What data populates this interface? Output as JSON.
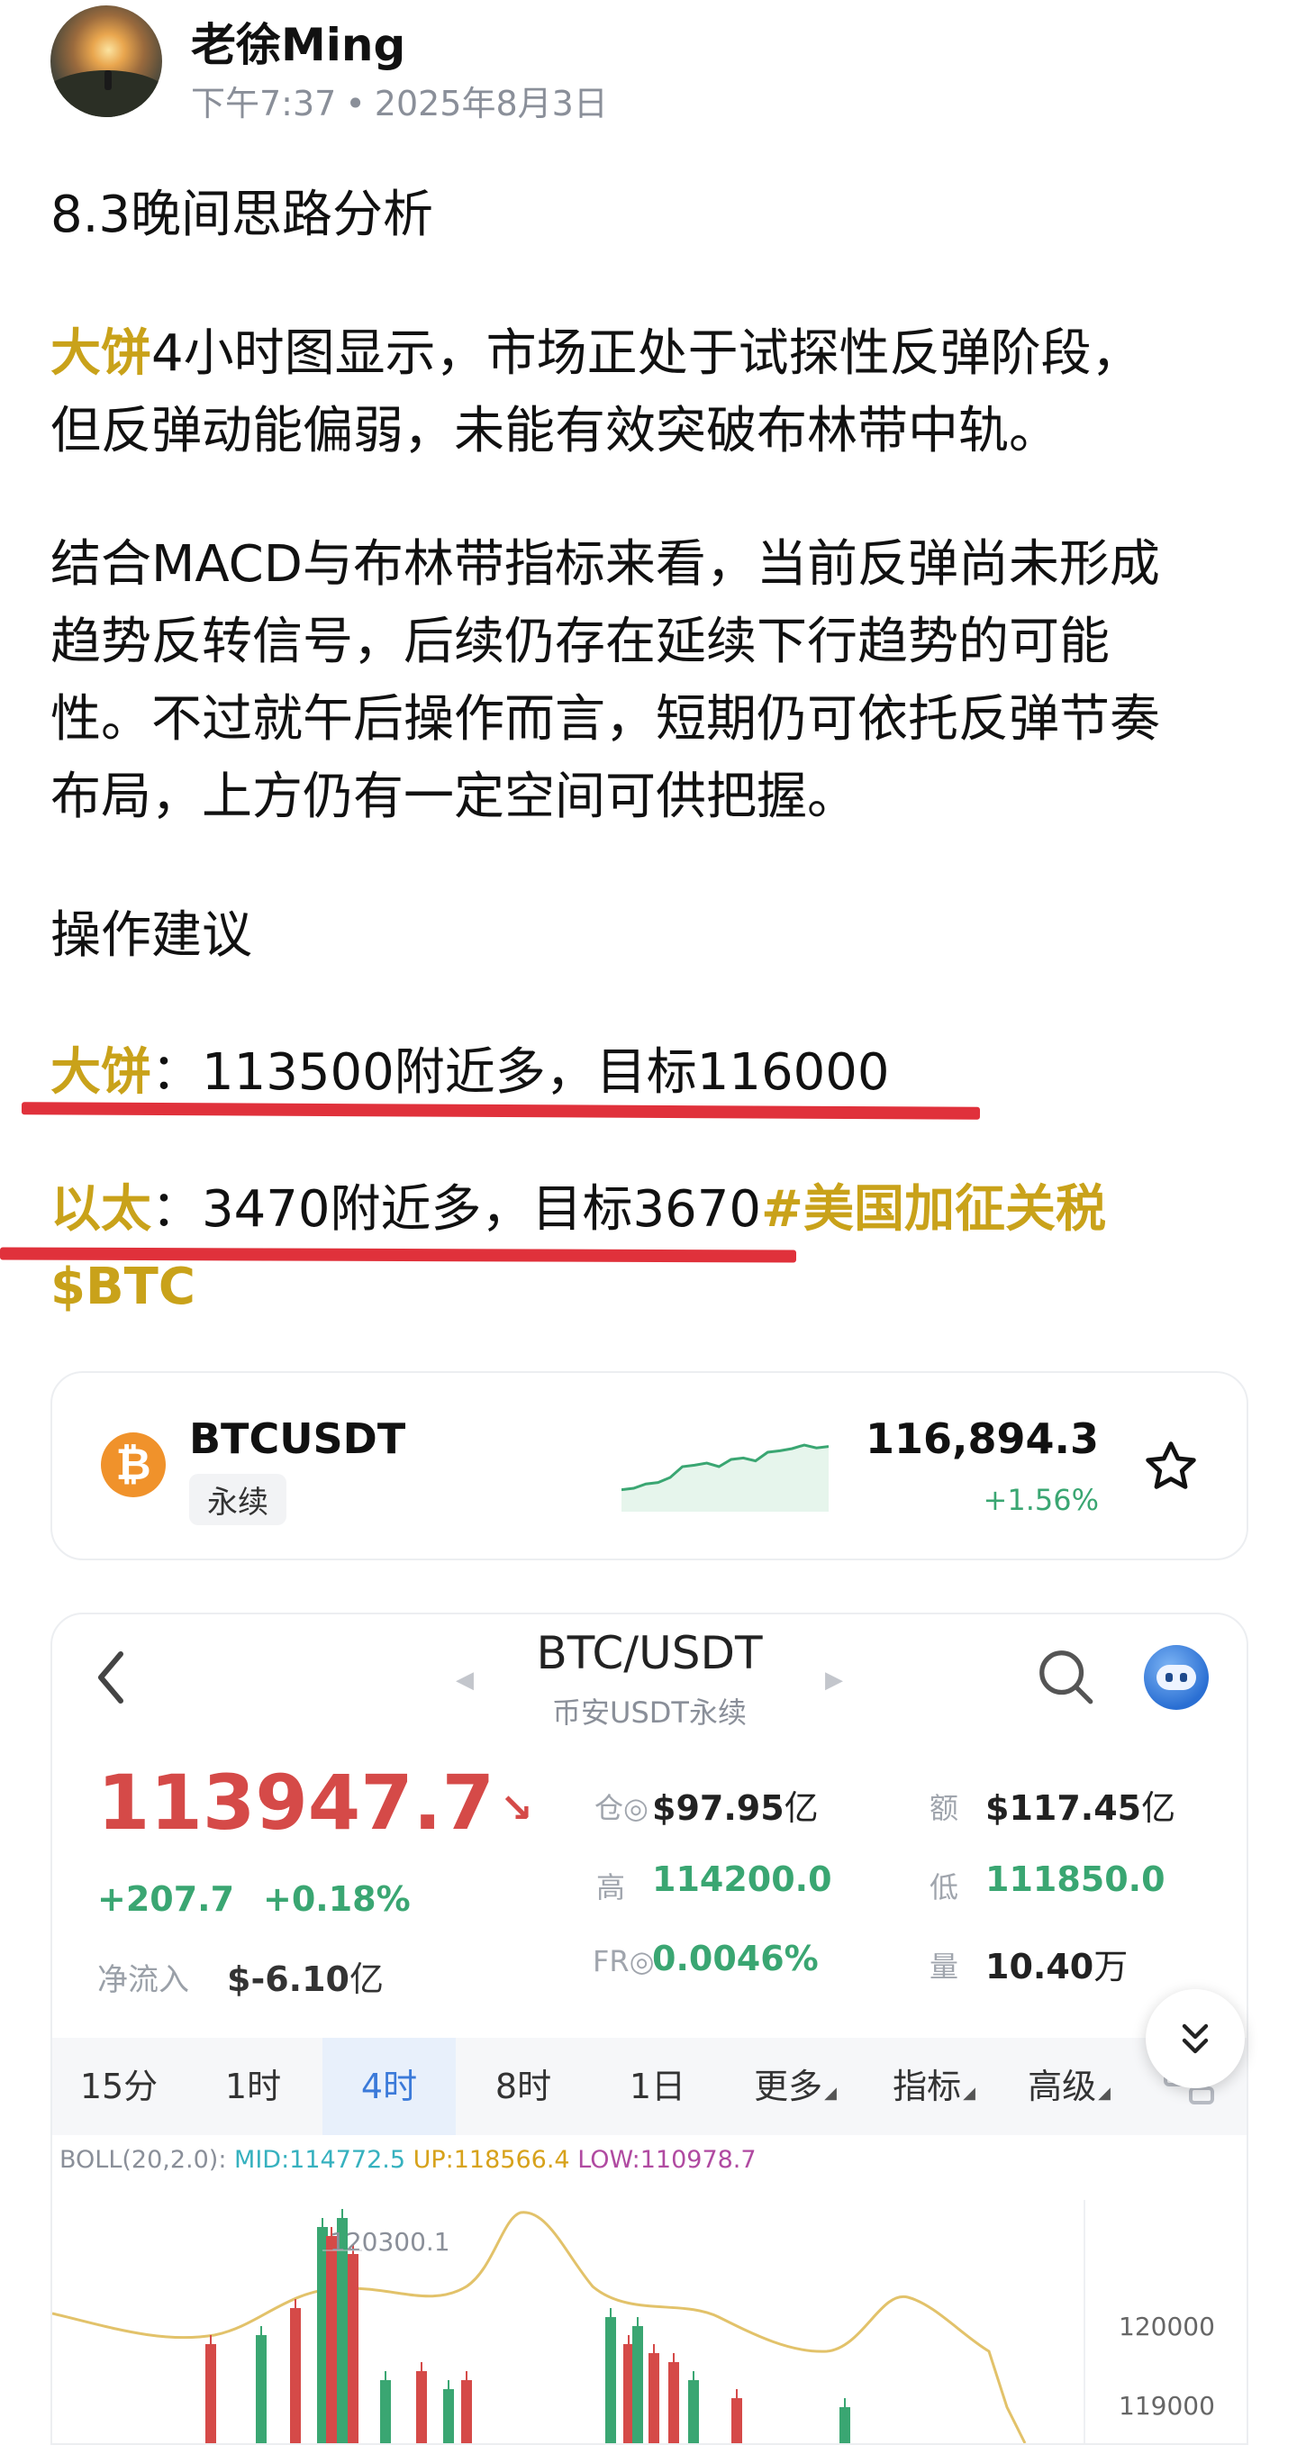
{
  "author": {
    "name": "老徐Ming",
    "time": "下午7:37",
    "separator": "•",
    "date": "2025年8月3日"
  },
  "post": {
    "title": "8.3晚间思路分析",
    "p1_highlight": "大饼",
    "p1_line1_rest": "4小时图显示，市场正处于试探性反弹阶段，",
    "p1_line2": "但反弹动能偏弱，未能有效突破布林带中轨。",
    "p2_lines": [
      "结合MACD与布林带指标来看，当前反弹尚未形成",
      "趋势反转信号，后续仍存在延续下行趋势的可能",
      "性。不过就午后操作而言，短期仍可依托反弹节奏",
      "布局，上方仍有一定空间可供把握。"
    ],
    "p3": "操作建议",
    "btc_label": "大饼",
    "btc_text": "：113500附近多，目标116000",
    "eth_label": "以太",
    "eth_text": "：3470附近多，目标3670",
    "hashtag": "#美国加征关税",
    "cashtag": "$BTC"
  },
  "ticker": {
    "icon": "bitcoin-icon",
    "logo_glyph": "₿",
    "symbol": "BTCUSDT",
    "type": "永续",
    "price": "116,894.3",
    "change": "+1.56%",
    "sparkline": [
      0.18,
      0.2,
      0.26,
      0.28,
      0.35,
      0.5,
      0.52,
      0.55,
      0.5,
      0.6,
      0.62,
      0.58,
      0.7,
      0.72,
      0.75,
      0.8,
      0.76,
      0.78
    ]
  },
  "chart_panel": {
    "pair": "BTC/USDT",
    "subtitle": "币安USDT永续",
    "last_price": "113947.7",
    "price_arrow": "↘",
    "change_abs": "+207.7",
    "change_pct": "+0.18%",
    "net_inflow_label": "净流入",
    "net_inflow_value": "$-6.10",
    "net_inflow_unit": "亿",
    "stats": {
      "oi_label": "仓◎",
      "oi_value": "$97.95",
      "oi_unit": "亿",
      "turnover_label": "额",
      "turnover_value": "$117.45",
      "turnover_unit": "亿",
      "high_label": "高",
      "high_value": "114200.0",
      "low_label": "低",
      "low_value": "111850.0",
      "fr_label": "FR◎",
      "fr_value": "0.0046%",
      "vol_label": "量",
      "vol_value": "10.40",
      "vol_unit": "万"
    },
    "tabs": [
      "15分",
      "1时",
      "4时",
      "8时",
      "1日",
      "更多",
      "指标",
      "高级"
    ],
    "active_tab": "4时",
    "boll": {
      "label": "BOLL(20,2.0):",
      "mid": "MID:114772.5",
      "up": "UP:118566.4",
      "low": "LOW:110978.7"
    },
    "y_ticks": [
      "120000",
      "119000"
    ],
    "peak_label": "120300.1",
    "colors": {
      "up_candle": "#3aa672",
      "down_candle": "#d54a48",
      "boll_line": "#e2c26a",
      "accent": "#3b7ad9"
    }
  }
}
